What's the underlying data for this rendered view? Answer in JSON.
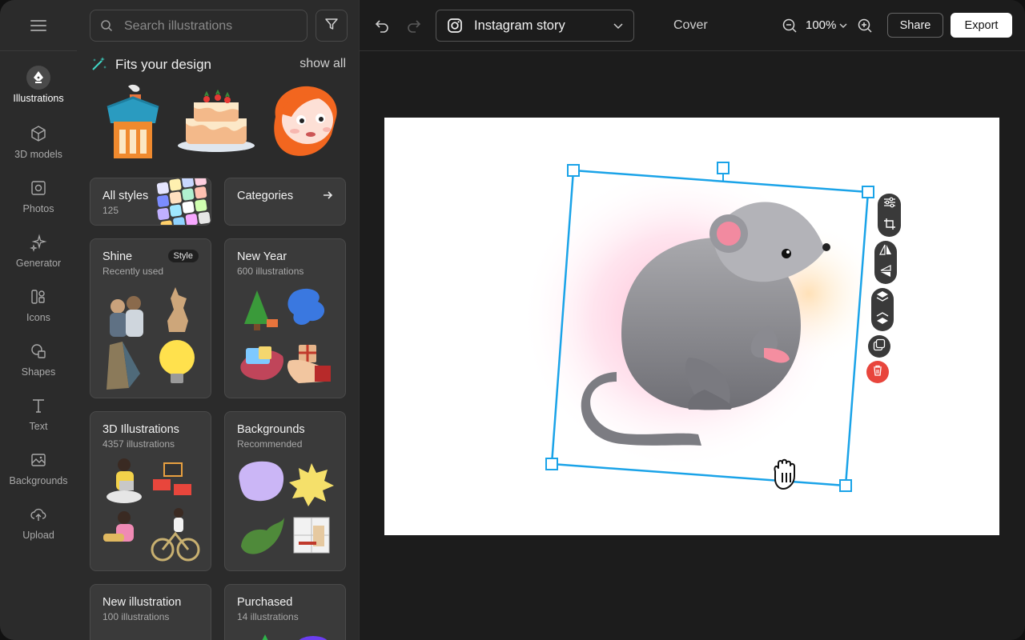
{
  "rail": {
    "items": [
      {
        "label": "Illustrations",
        "icon": "pen-nib-icon"
      },
      {
        "label": "3D models",
        "icon": "cube-icon"
      },
      {
        "label": "Photos",
        "icon": "camera-icon"
      },
      {
        "label": "Generator",
        "icon": "sparkles-icon"
      },
      {
        "label": "Icons",
        "icon": "icons-icon"
      },
      {
        "label": "Shapes",
        "icon": "shapes-icon"
      },
      {
        "label": "Text",
        "icon": "text-icon"
      },
      {
        "label": "Backgrounds",
        "icon": "image-icon"
      },
      {
        "label": "Upload",
        "icon": "upload-cloud-icon"
      }
    ]
  },
  "panel": {
    "search_placeholder": "Search illustrations",
    "fits_title": "Fits your design",
    "show_all": "show all",
    "cards": [
      {
        "title": "All styles",
        "sub": "125"
      },
      {
        "title": "Categories",
        "sub": ""
      },
      {
        "title": "Shine",
        "sub": "Recently used",
        "badge": "Style"
      },
      {
        "title": "New Year",
        "sub": "600 illustrations"
      },
      {
        "title": "3D Illustrations",
        "sub": "4357 illustrations"
      },
      {
        "title": "Backgrounds",
        "sub": "Recommended"
      },
      {
        "title": "New illustration",
        "sub": "100 illustrations"
      },
      {
        "title": "Purchased",
        "sub": "14 illustrations"
      }
    ]
  },
  "topbar": {
    "format": "Instagram story",
    "cover": "Cover",
    "zoom": "100%",
    "share": "Share",
    "export": "Export"
  },
  "colors": {
    "selection": "#1aa3e8",
    "delete": "#e8453c",
    "panel_bg": "#2b2b2b"
  }
}
